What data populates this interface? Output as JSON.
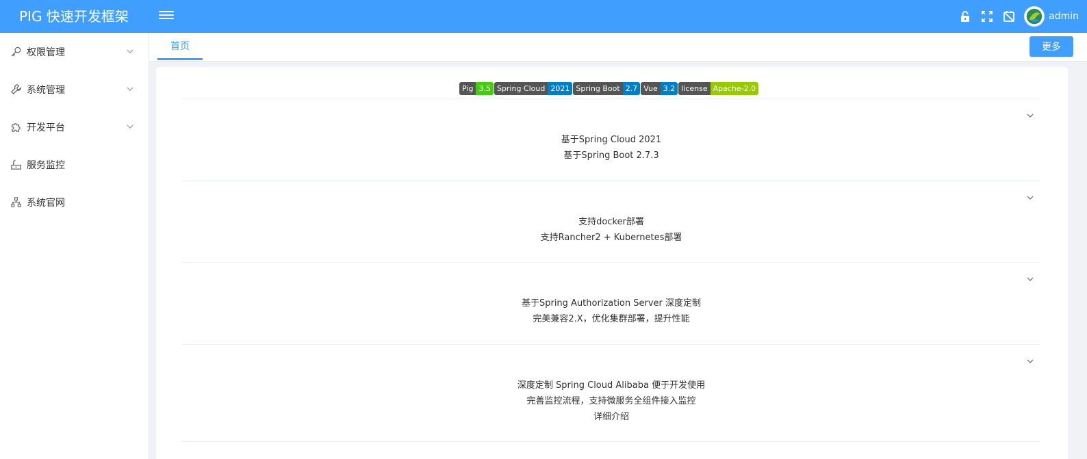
{
  "header": {
    "brand": "PIG 快速开发框架",
    "username": "admin",
    "icons": [
      "lock-icon",
      "fullscreen-icon",
      "theme-icon"
    ],
    "accent": "#409eff"
  },
  "sidebar": {
    "items": [
      {
        "label": "权限管理",
        "icon": "key-icon",
        "expandable": true
      },
      {
        "label": "系统管理",
        "icon": "wrench-icon",
        "expandable": true
      },
      {
        "label": "开发平台",
        "icon": "puzzle-icon",
        "expandable": true
      },
      {
        "label": "服务监控",
        "icon": "monitor-icon",
        "expandable": false
      },
      {
        "label": "系统官网",
        "icon": "sitemap-icon",
        "expandable": false
      }
    ]
  },
  "tabs": {
    "items": [
      {
        "label": "首页"
      }
    ],
    "more_label": "更多"
  },
  "badges": [
    {
      "key": "Pig",
      "value": "3.5",
      "color": "#4c1"
    },
    {
      "key": "Spring Cloud",
      "value": "2021",
      "color": "#007ec6"
    },
    {
      "key": "Spring Boot",
      "value": "2.7",
      "color": "#007ec6"
    },
    {
      "key": "Vue",
      "value": "3.2",
      "color": "#007ec6"
    },
    {
      "key": "license",
      "value": "Apache-2.0",
      "color": "#97ca00"
    }
  ],
  "features": [
    {
      "lines": [
        "基于Spring Cloud 2021",
        "基于Spring Boot 2.7.3"
      ]
    },
    {
      "lines": [
        "支持docker部署",
        "支持Rancher2 + Kubernetes部署"
      ]
    },
    {
      "lines": [
        "基于Spring Authorization Server 深度定制",
        "完美兼容2.X，优化集群部署，提升性能"
      ]
    },
    {
      "lines": [
        "深度定制 Spring Cloud Alibaba 便于开发使用",
        "完善监控流程，支持微服务全组件接入监控",
        "详细介绍"
      ]
    }
  ]
}
